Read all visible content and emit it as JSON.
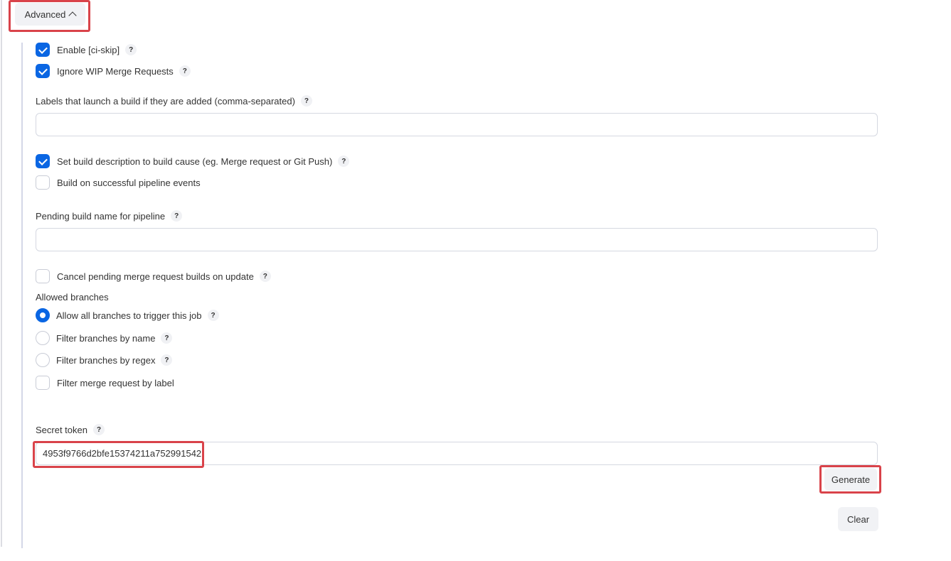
{
  "advanced": {
    "label": "Advanced"
  },
  "options": {
    "enable_ci_skip": {
      "label": "Enable [ci-skip]",
      "checked": true
    },
    "ignore_wip": {
      "label": "Ignore WIP Merge Requests",
      "checked": true
    },
    "labels_launch": {
      "label": "Labels that launch a build if they are added (comma-separated)",
      "value": ""
    },
    "set_build_description": {
      "label": "Set build description to build cause (eg. Merge request or Git Push)",
      "checked": true
    },
    "build_on_pipeline": {
      "label": "Build on successful pipeline events",
      "checked": false
    },
    "pending_build_name": {
      "label": "Pending build name for pipeline",
      "value": ""
    },
    "cancel_pending": {
      "label": "Cancel pending merge request builds on update",
      "checked": false
    }
  },
  "allowed_branches": {
    "label": "Allowed branches",
    "options": [
      {
        "label": "Allow all branches to trigger this job",
        "selected": true
      },
      {
        "label": "Filter branches by name",
        "selected": false
      },
      {
        "label": "Filter branches by regex",
        "selected": false
      }
    ],
    "filter_by_label": {
      "label": "Filter merge request by label",
      "checked": false
    }
  },
  "secret_token": {
    "label": "Secret token",
    "value": "4953f9766d2bfe15374211a752991542"
  },
  "buttons": {
    "generate": "Generate",
    "clear": "Clear"
  },
  "help_glyph": "?",
  "colors": {
    "accent": "#0a66e3",
    "highlight": "#d9434a",
    "button_bg": "#f1f2f5"
  }
}
